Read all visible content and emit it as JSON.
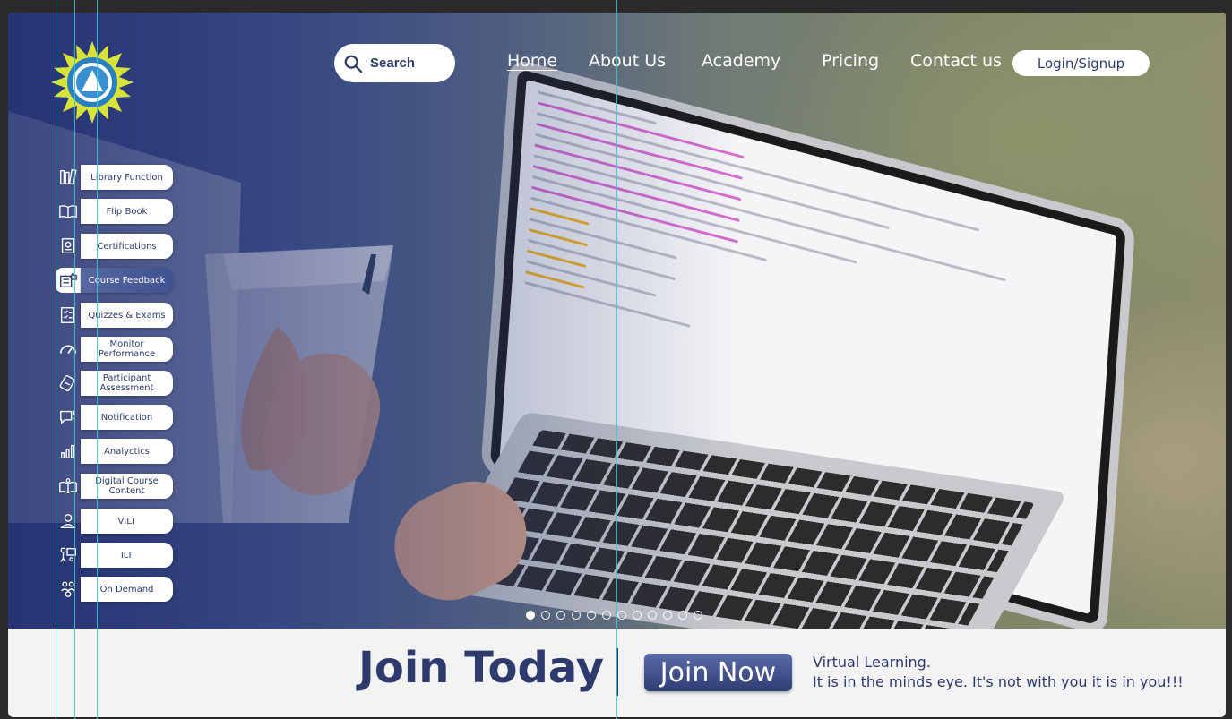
{
  "brand": {
    "logo_name": "quality-circle-logo"
  },
  "header": {
    "search": {
      "placeholder": "Search"
    },
    "nav": [
      {
        "label": "Home",
        "active": true
      },
      {
        "label": "About Us"
      },
      {
        "label": "Academy"
      },
      {
        "label": "Pricing"
      },
      {
        "label": "Contact us"
      }
    ],
    "login_label": "Login/Signup"
  },
  "sidebar": {
    "items": [
      {
        "label": "Library Function",
        "icon": "library-icon"
      },
      {
        "label": "Flip Book",
        "icon": "flip-book-icon"
      },
      {
        "label": "Certifications",
        "icon": "certificate-icon"
      },
      {
        "label": "Course Feedback",
        "icon": "feedback-icon",
        "active": true
      },
      {
        "label": "Quizzes & Exams",
        "icon": "quiz-icon"
      },
      {
        "label": "Monitor Performance",
        "icon": "gauge-icon"
      },
      {
        "label": "Participant Assessment",
        "icon": "assessment-icon"
      },
      {
        "label": "Notification",
        "icon": "notification-icon"
      },
      {
        "label": "Analyctics",
        "icon": "analytics-icon"
      },
      {
        "label": "Digital Course Content",
        "icon": "digital-content-icon"
      },
      {
        "label": "VILT",
        "icon": "virtual-class-icon"
      },
      {
        "label": "ILT",
        "icon": "instructor-icon"
      },
      {
        "label": "On Demand",
        "icon": "on-demand-icon"
      }
    ]
  },
  "carousel": {
    "total": 12,
    "active_index": 0
  },
  "footer": {
    "heading": "Join Today",
    "cta_label": "Join Now",
    "tagline_1": "Virtual Learning.",
    "tagline_2": "It is in the minds eye. It's not with you it is in you!!!"
  },
  "colors": {
    "brand_navy": "#2e3a6b",
    "accent_blue": "#4b5e9c",
    "guide_cyan": "#35c9d6"
  }
}
